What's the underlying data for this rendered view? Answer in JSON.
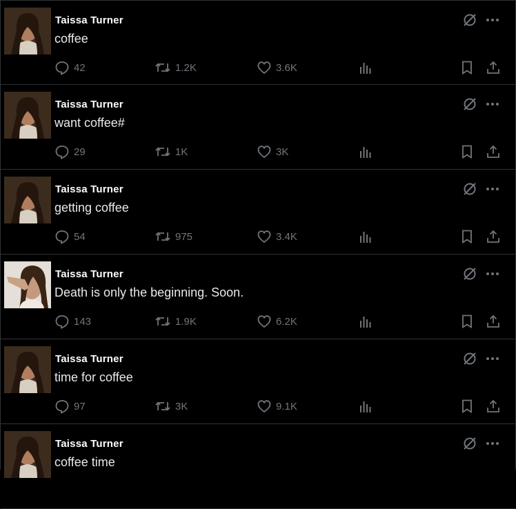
{
  "colors": {
    "background": "#000000",
    "divider": "#2f3336",
    "muted": "#71767b",
    "text": "#e7e9ea"
  },
  "icons": {
    "reply": "speech-bubble-icon",
    "repost": "repost-arrows-icon",
    "like": "heart-icon",
    "views": "bar-chart-icon",
    "bookmark": "bookmark-icon",
    "share": "share-upload-icon",
    "grok": "slashed-circle-icon",
    "more": "more-dots-icon"
  },
  "posts": [
    {
      "author": "Taissa Turner",
      "text": "coffee",
      "replies": "42",
      "reposts": "1.2K",
      "likes": "3.6K"
    },
    {
      "author": "Taissa Turner",
      "text": "want coffee#",
      "replies": "29",
      "reposts": "1K",
      "likes": "3K"
    },
    {
      "author": "Taissa Turner",
      "text": "getting coffee",
      "replies": "54",
      "reposts": "975",
      "likes": "3.4K"
    },
    {
      "author": "Taissa Turner",
      "text": "Death is only the beginning. Soon.",
      "replies": "143",
      "reposts": "1.9K",
      "likes": "6.2K"
    },
    {
      "author": "Taissa Turner",
      "text": "time for coffee",
      "replies": "97",
      "reposts": "3K",
      "likes": "9.1K"
    },
    {
      "author": "Taissa Turner",
      "text": "coffee time",
      "replies": "",
      "reposts": "",
      "likes": ""
    }
  ]
}
